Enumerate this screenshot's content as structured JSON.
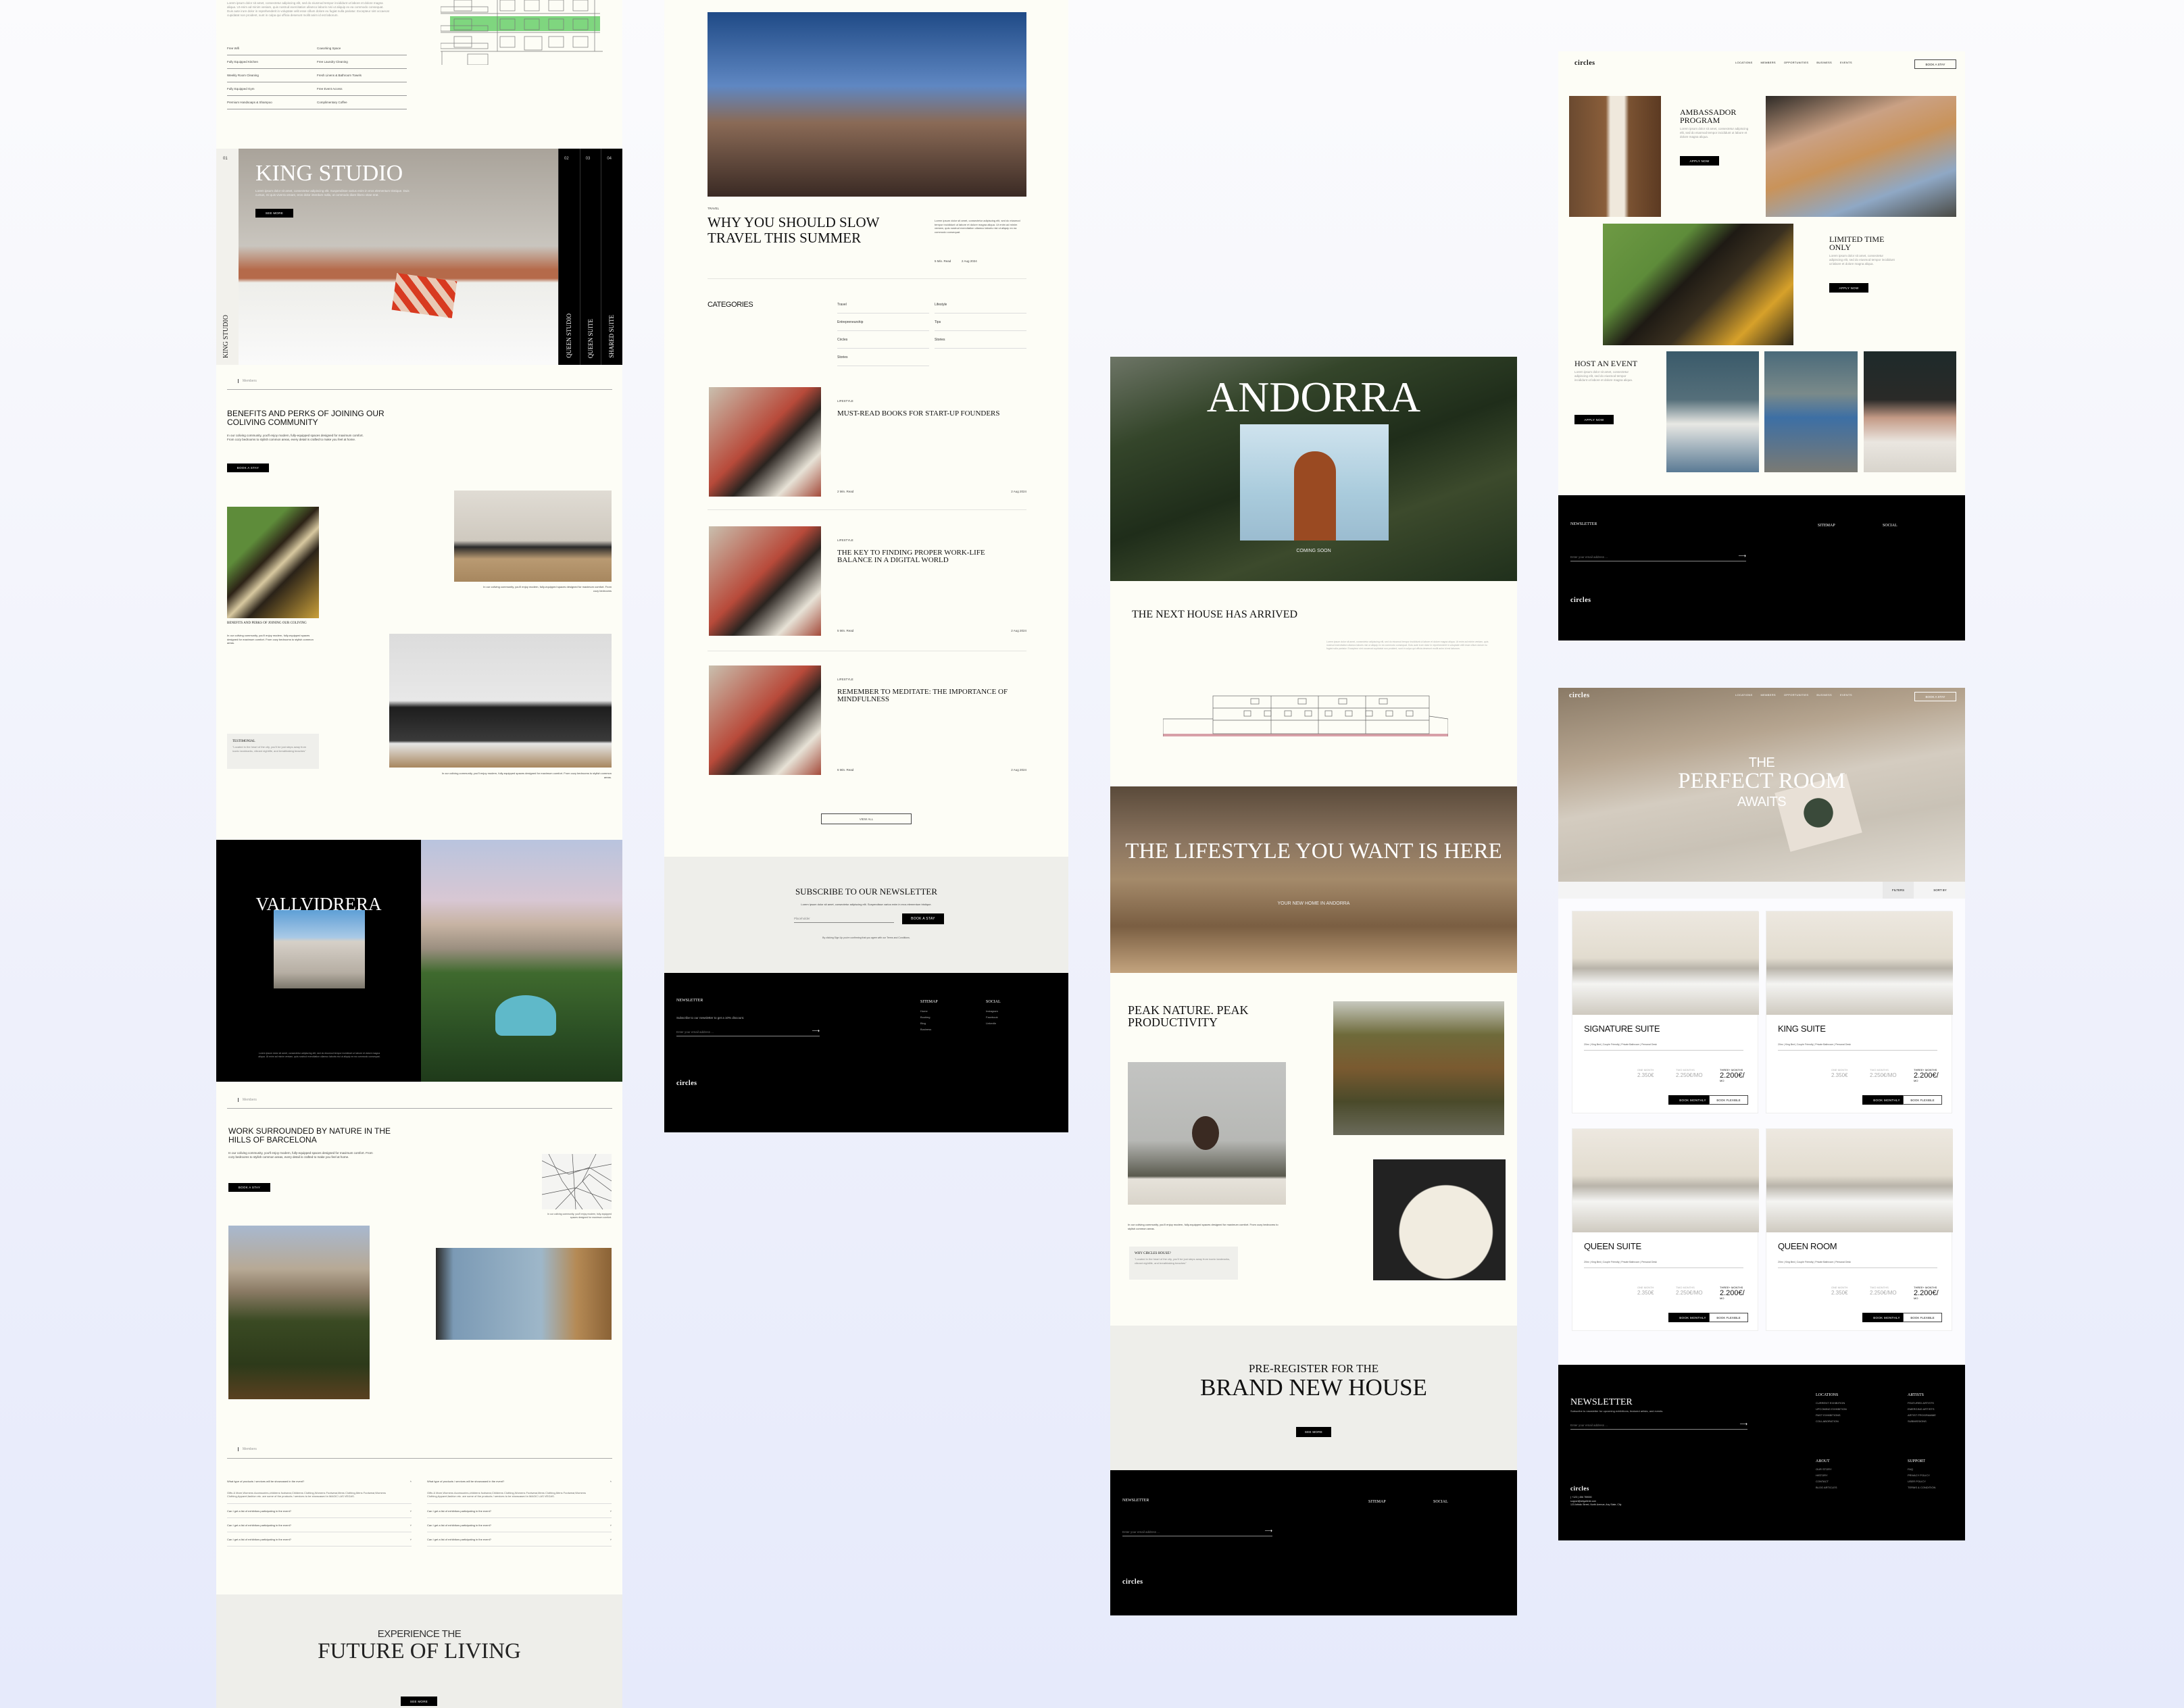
{
  "living": {
    "intro_lorem": "Lorem ipsum dolor sit amet, consectetur adipiscing elit, sed do eiusmod tempor incididunt ut labore et dolore magna aliqua. Ut enim ad minim veniam, quis nostrud exercitation ullamco laboris nisi ut aliquip ex ea commodo consequat. Duis aute irure dolor in reprehenderit in voluptate velit esse cillum dolore eu fugiat nulla pariatur. Excepteur sint occaecat cupidatat non proident, sunt in culpa qui officia deserunt mollit anim id est laborum.",
    "amenities": [
      "Free Wifi",
      "Coworking Space",
      "Fully Equipped Kitchen",
      "Free Laundry Cleaning",
      "Weekly Room Cleaning",
      "Fresh Linens & Bathroom Towels",
      "Fully Equipped Gym",
      "Free Event Access",
      "Premium Handsoaps & Shampoo",
      "Complimentary Coffee"
    ],
    "slider": {
      "active_index": "01",
      "active_title": "KING STUDIO",
      "desc": "Lorem ipsum dolor sit amet, consectetur adipiscing elit. Suspendisse varius enim in eros elementum tristique. Duis cursus, mi quis viverra ornare, eros dolor interdum nulla, ut commodo diam libero vitae erat.",
      "see_more": "SEE MORE",
      "tabs": [
        {
          "index": "02",
          "label": "QUEEN STUDIO"
        },
        {
          "index": "03",
          "label": "QUEEN SUITE"
        },
        {
          "index": "04",
          "label": "SHARED SUITE"
        }
      ]
    },
    "members_label": "Members",
    "benefits": {
      "title": "BENEFITS AND PERKS OF JOINING OUR COLIVING COMMUNITY",
      "para": "In our coliving community, you'll enjoy modern, fully-equipped spaces designed for maximum comfort. From cozy bedrooms to stylish common areas, every detail is crafted to make you feel at home.",
      "button": "BOOK A STAY",
      "card_title": "BENEFITS AND PERKS OF JOINING OUR COLIVING",
      "card_para": "In our coliving community, you'll enjoy modern, fully-equipped spaces designed for maximum comfort. From cozy bedrooms to stylish common areas.",
      "gym_caption": "In our coliving community, you'll enjoy modern, fully-equipped spaces designed for maximum comfort. From cozy bedrooms",
      "office_caption": "In our coliving community, you'll enjoy modern, fully-equipped spaces designed for maximum comfort. From cozy bedrooms to stylish common areas.",
      "testimonial_title": "TESTIMONIAL",
      "testimonial_quote": "\"Located in the heart of the city, you'll be just steps away from iconic landmarks, vibrant nightlife, and breathtaking beaches\""
    },
    "vallvidrera": {
      "title": "VALLVIDRERA",
      "lorem": "Lorem ipsum dolor sit amet, consectetur adipiscing elit, sed do eiusmod tempor incididunt ut labore et dolore magna aliqua. Ut enim ad minim veniam, quis nostrud exercitation ullamco laboris nisi ut aliquip ex ea commodo consequat."
    },
    "nature": {
      "title": "WORK SURROUNDED BY NATURE IN THE HILLS OF BARCELONA",
      "para": "In our coliving community, you'll enjoy modern, fully-equipped spaces designed for maximum comfort. From cozy bedrooms to stylish common areas, every detail is crafted to make you feel at home.",
      "button": "BOOK A STAY",
      "map_caption": "In our coliving community, you'll enjoy modern, fully-equipped spaces designed for maximum comfort."
    },
    "faq": {
      "open_question": "What type of products / services will be showcased in the event?",
      "open_answer": "Gifts & More,Womens Accessories,childrens footwear,Childrens Clothing,Womens Footwear,Mens Clothing,Mens Footwear,Womens Clothing,Apparel,fashion etc. are some of the products / services to be showcased in MAGIC LAS VEGAS.",
      "left": [
        "Can I get a list of exhibitors participating in the event?",
        "Can I get a list of exhibitors participating in the event?",
        "Can I get a list of exhibitors participating in the event?"
      ],
      "right": [
        "Can I get a list of exhibitors participating in the event?",
        "Can I get a list of exhibitors participating in the event?",
        "Can I get a list of exhibitors participating in the event?"
      ]
    },
    "cta": {
      "line1": "EXPERIENCE THE",
      "line2": "FUTURE OF LIVING",
      "button": "SEE MORE"
    }
  },
  "blog": {
    "featured": {
      "category": "TRAVEL",
      "title": "WHY YOU SHOULD SLOW TRAVEL THIS SUMMER",
      "excerpt": "Lorem ipsum dolor sit amet, consectetur adipiscing elit, sed do eiusmod tempor incididunt ut labore et dolore magna aliqua. Ut enim ad minim veniam, quis nostrud exercitation ullamco laboris nisi ut aliquip ex ea commodo consequat.",
      "read_time": "5 Min. Read",
      "date": "2 Aug 2024"
    },
    "categories_title": "CATEGORIES",
    "categories": [
      "Travel",
      "Lifestyle",
      "Entrepreneurship",
      "Tips",
      "Circles",
      "Stories",
      "Stories"
    ],
    "articles": [
      {
        "category": "LIFESTYLE",
        "title": "MUST-READ BOOKS FOR START-UP FOUNDERS",
        "read_time": "2 Min. Read",
        "date": "2 Aug 2024"
      },
      {
        "category": "LIFESTYLE",
        "title": "THE KEY TO FINDING PROPER WORK-LIFE BALANCE IN A DIGITAL WORLD",
        "read_time": "5 Min. Read",
        "date": "2 Aug 2024"
      },
      {
        "category": "LIFESTYLE",
        "title": "REMEMBER TO MEDITATE: THE IMPORTANCE OF MINDFULNESS",
        "read_time": "6 Min. Read",
        "date": "2 Aug 2024"
      }
    ],
    "view_all": "VIEW ALL",
    "subscribe": {
      "title": "SUBSCRIBE TO OUR NEWSLETTER",
      "lorem": "Lorem ipsum dolor sit amet, consectetur adipiscing elit. Suspendisse varius enim in eros elementum tristique.",
      "placeholder": "Placeholder",
      "button": "BOOK A STAY",
      "terms": "By clicking Sign Up you're confirming that you agree with our Terms and Conditions."
    },
    "footer": {
      "newsletter": "NEWSLETTER",
      "sub": "Subscribe to our newsletter to get a 10% discount.",
      "email_placeholder": "Enter your email address ...",
      "sitemap_title": "SITEMAP",
      "sitemap": [
        "Home",
        "Booking",
        "Blog",
        "Business"
      ],
      "social_title": "SOCIAL",
      "social": [
        "Instagram",
        "Facebook",
        "LinkedIn"
      ],
      "logo": "circles"
    }
  },
  "andorra": {
    "hero_title": "ANDORRA",
    "coming_soon": "COMING SOON",
    "next_title": "THE NEXT HOUSE HAS ARRIVED",
    "next_lorem": "Lorem ipsum dolor sit amet, consectetur adipiscing elit, sed do eiusmod tempor incididunt ut labore et dolore magna aliqua. Ut enim ad minim veniam, quis nostrud exercitation ullamco laboris nisi ut aliquip ex ea commodo consequat. Duis aute irure dolor in reprehenderit in voluptate velit esse cillum dolore eu fugiat nulla pariatur. Excepteur sint occaecat cupidatat non proident, sunt in culpa qui officia deserunt mollit anim id est laborum.",
    "lifestyle_title": "THE LIFESTYLE YOU WANT IS HERE",
    "lifestyle_sub": "YOUR NEW HOME IN ANDORRA",
    "peak_title": "PEAK NATURE. PEAK PRODUCTIVITY",
    "peak_para": "In our coliving community, you'll enjoy modern, fully-equipped spaces designed for maximum comfort. From cozy bedrooms to stylish common areas.",
    "why_title": "WHY CIRCLES HOUSE?",
    "why_quote": "\"Located in the heart of the city, you'll be just steps away from iconic landmarks, vibrant nightlife, and breathtaking beaches\"",
    "cta_line1": "PRE-REGISTER FOR THE",
    "cta_line2": "BRAND NEW HOUSE",
    "cta_button": "SEE MORE",
    "footer": {
      "newsletter": "NEWSLETTER",
      "email_placeholder": "Enter your email address ...",
      "sitemap_title": "SITEMAP",
      "social_title": "SOCIAL",
      "logo": "circles"
    }
  },
  "events": {
    "logo": "circles",
    "nav": [
      "LOCATIONS",
      "MEMBERS",
      "OPPORTUNITIES",
      "BUSINESS",
      "EVENTS"
    ],
    "book": "BOOK A STAY",
    "blocks": [
      {
        "title": "AMBASSADOR PROGRAM",
        "lorem": "Lorem ipsum dolor sit amet, consectetur adipiscing elit, sed do eiusmod tempor incididunt ut labore et dolore magna aliqua.",
        "button": "APPLY NOW"
      },
      {
        "title": "LIMITED TIME ONLY",
        "lorem": "Lorem ipsum dolor sit amet, consectetur adipiscing elit, sed do eiusmod tempor incididunt ut labore et dolore magna aliqua.",
        "button": "APPLY NOW"
      },
      {
        "title": "HOST AN EVENT",
        "lorem": "Lorem ipsum dolor sit amet, consectetur adipiscing elit, sed do eiusmod tempor incididunt ut labore et dolore magna aliqua.",
        "button": "APPLY NOW"
      }
    ],
    "footer": {
      "newsletter": "NEWSLETTER",
      "email_placeholder": "Enter your email address ...",
      "sitemap_title": "SITEMAP",
      "social_title": "SOCIAL",
      "logo": "circles"
    }
  },
  "rooms": {
    "logo": "circles",
    "nav": [
      "LOCATIONS",
      "MEMBERS",
      "OPPORTUNITIES",
      "BUSINESS",
      "EVENTS"
    ],
    "book": "BOOK A STAY",
    "hero": {
      "line1": "THE",
      "line2": "PERFECT ROOM",
      "line3": "AWAITS"
    },
    "filters": "FILTERS",
    "sort": "SORT BY",
    "cards": [
      {
        "title": "SIGNATURE SUITE",
        "specs": "20m² | King Bed | Couple Friendly | Private Bathroom | Personal Desk",
        "p1_label": "ONE MONTH",
        "p1": "2.350€",
        "p2_label": "TWO MONTHS",
        "p2": "2.250€/MO",
        "p3_label": "THREE+ MONTHS",
        "p3": "2.200€/",
        "p3_unit": "MO",
        "btn1": "BOOK MONTHLY",
        "btn2": "BOOK FLEXIBLE"
      },
      {
        "title": "KING SUITE",
        "specs": "20m² | King Bed | Couple Friendly | Private Bathroom | Personal Desk",
        "p1_label": "ONE MONTH",
        "p1": "2.350€",
        "p2_label": "TWO MONTHS",
        "p2": "2.250€/MO",
        "p3_label": "THREE+ MONTHS",
        "p3": "2.200€/",
        "p3_unit": "MO",
        "btn1": "BOOK MONTHLY",
        "btn2": "BOOK FLEXIBLE"
      },
      {
        "title": "QUEEN SUITE",
        "specs": "20m² | King Bed | Couple Friendly | Private Bathroom | Personal Desk",
        "p1_label": "ONE MONTH",
        "p1": "2.350€",
        "p2_label": "TWO MONTHS",
        "p2": "2.250€/MO",
        "p3_label": "THREE+ MONTHS",
        "p3": "2.200€/",
        "p3_unit": "MO",
        "btn1": "BOOK MONTHLY",
        "btn2": "BOOK FLEXIBLE"
      },
      {
        "title": "QUEEN ROOM",
        "specs": "20m² | King Bed | Couple Friendly | Private Bathroom | Personal Desk",
        "p1_label": "ONE MONTH",
        "p1": "2.350€",
        "p2_label": "TWO MONTHS",
        "p2": "2.250€/MO",
        "p3_label": "THREE+ MONTHS",
        "p3": "2.200€/",
        "p3_unit": "MO",
        "btn1": "BOOK MONTHLY",
        "btn2": "BOOK FLEXIBLE"
      }
    ],
    "footer": {
      "newsletter": "NEWSLETTER",
      "sub": "Subscribe to newsletter for upcoming exhibitions, featured artists, and events.",
      "email_placeholder": "Enter your email address ...",
      "logo": "circles",
      "phone": "( +123 ) 456 789000",
      "email": "support@artgallerie.com",
      "address": "123 Artistic Street, North Avenue, Any State, City",
      "locations_title": "LOCATIONS",
      "locations": [
        "CURRENT EXHIBITION",
        "UPCOMING EXHIBITION",
        "PAST EXHIBITIONS",
        "COLLABORATION"
      ],
      "artists_title": "ARTISTS",
      "artists": [
        "FEATURED ARTISTS",
        "EMERGING ARTISTS",
        "ARTIST PROGRAMME",
        "SUBMISSIONS"
      ],
      "about_title": "ABOUT",
      "about": [
        "OUR STORY",
        "HISTORY",
        "CONTACT",
        "BLOG ARTICLES"
      ],
      "support_title": "SUPPORT",
      "support": [
        "FAQ",
        "PRIVACY POLICY",
        "USER POLICY",
        "TERMS & CONDITION"
      ]
    }
  },
  "colors": {
    "page_bg": "#fdfdf6",
    "dark": "#000000",
    "cta_grey": "#eeeeea",
    "plan_highlight": "#7fd67f"
  }
}
